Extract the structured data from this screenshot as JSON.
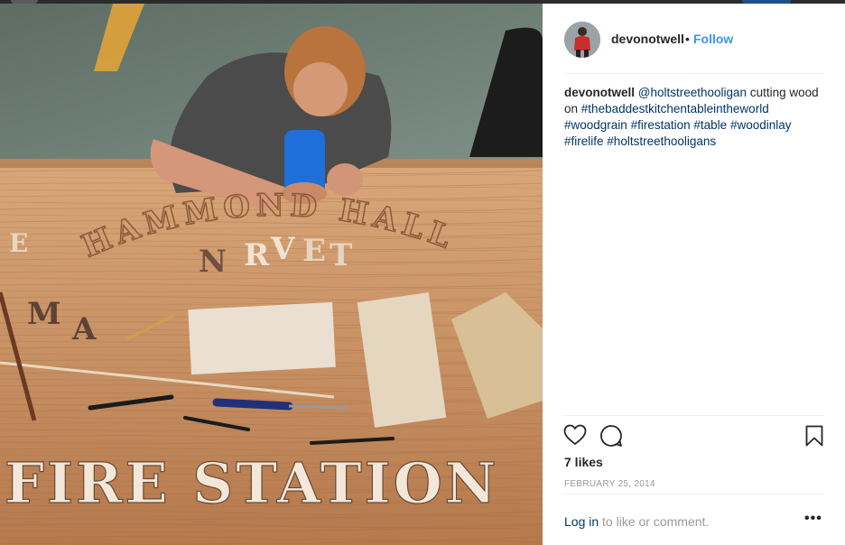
{
  "post": {
    "username": "devonotwell",
    "separator": "•",
    "follow_label": "Follow",
    "caption": {
      "username": "devonotwell",
      "mention": "@holtstreethooligan",
      "text_1": "cutting wood on",
      "tags": [
        "#thebaddestkitchentableintheworld",
        "#woodgrain",
        "#firestation",
        "#table",
        "#woodinlay",
        "#firelife",
        "#holtstreethooligans"
      ]
    },
    "likes": "7 likes",
    "date": "FEBRUARY 25, 2014",
    "login_link": "Log in",
    "login_text": "to like or comment.",
    "more_label": "•••"
  },
  "photo": {
    "table_letters_bottom": "FIRE STATION",
    "table_letters_arc": "HAMMOND HALL"
  },
  "icons": {
    "like": "heart-icon",
    "comment": "comment-icon",
    "save": "bookmark-icon",
    "more": "more-icon"
  },
  "colors": {
    "link_blue": "#3897f0",
    "hashtag_blue": "#003569",
    "wood": "#c9956a"
  }
}
